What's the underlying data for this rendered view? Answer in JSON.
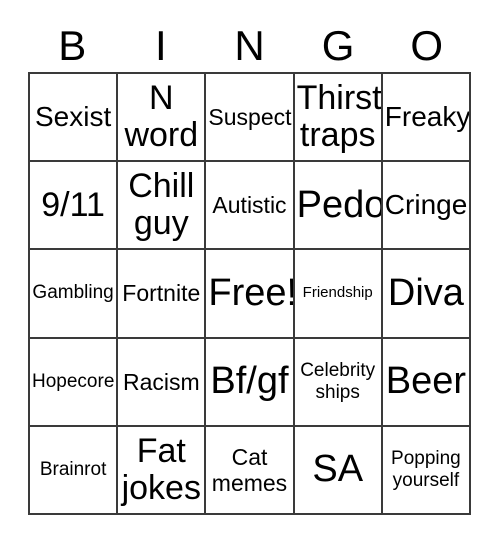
{
  "card": {
    "header_letters": [
      "B",
      "I",
      "N",
      "G",
      "O"
    ],
    "free_space_label": "Free!",
    "colors": {
      "background": "#ffffff",
      "border": "#3a3a3a",
      "text": "#000000"
    },
    "rows": [
      [
        {
          "label": "Sexist",
          "size": "l"
        },
        {
          "label": "N\nword",
          "size": "xl"
        },
        {
          "label": "Suspect",
          "size": "m"
        },
        {
          "label": "Thirst\ntraps",
          "size": "xl"
        },
        {
          "label": "Freaky",
          "size": "l"
        }
      ],
      [
        {
          "label": "9/11",
          "size": "xl"
        },
        {
          "label": "Chill\nguy",
          "size": "xl"
        },
        {
          "label": "Autistic",
          "size": "m"
        },
        {
          "label": "Pedo",
          "size": "xxl"
        },
        {
          "label": "Cringe",
          "size": "l"
        }
      ],
      [
        {
          "label": "Gambling",
          "size": "s"
        },
        {
          "label": "Fortnite",
          "size": "m"
        },
        {
          "label": "Free!",
          "size": "xxl"
        },
        {
          "label": "Friendship",
          "size": "xs"
        },
        {
          "label": "Diva",
          "size": "xxl"
        }
      ],
      [
        {
          "label": "Hopecore",
          "size": "s"
        },
        {
          "label": "Racism",
          "size": "m"
        },
        {
          "label": "Bf/gf",
          "size": "xxl"
        },
        {
          "label": "Celebrity\nships",
          "size": "s"
        },
        {
          "label": "Beer",
          "size": "xxl"
        }
      ],
      [
        {
          "label": "Brainrot",
          "size": "s"
        },
        {
          "label": "Fat\njokes",
          "size": "xl"
        },
        {
          "label": "Cat\nmemes",
          "size": "m"
        },
        {
          "label": "SA",
          "size": "xxl"
        },
        {
          "label": "Popping\nyourself",
          "size": "s"
        }
      ]
    ]
  }
}
